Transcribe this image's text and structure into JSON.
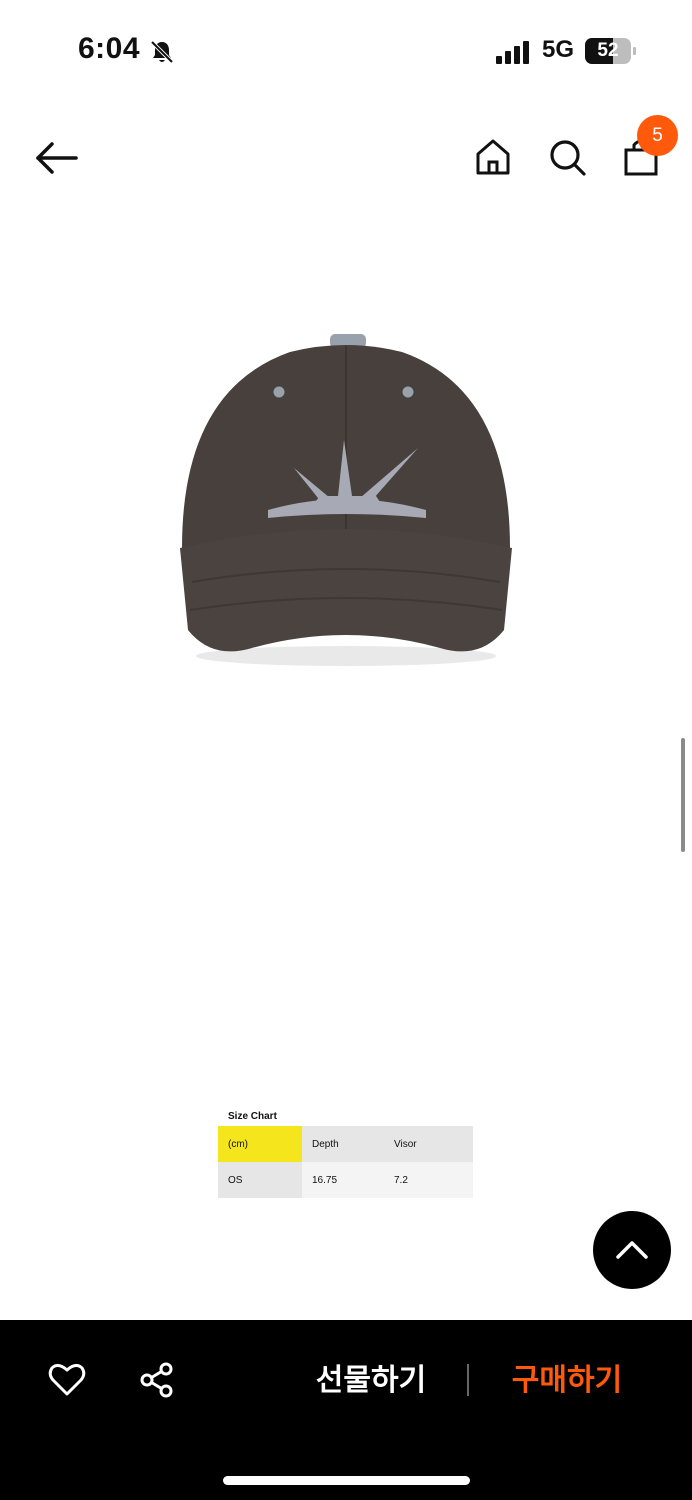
{
  "status": {
    "time": "6:04",
    "network": "5G",
    "battery": "52"
  },
  "nav": {
    "cart_count": "5"
  },
  "product": {
    "image_icon": "cap-product-image"
  },
  "size_chart": {
    "title": "Size Chart",
    "headers": [
      "(cm)",
      "Depth",
      "Visor"
    ],
    "rows": [
      [
        "OS",
        "16.75",
        "7.2"
      ]
    ],
    "highlight_color": "#f4e51c"
  },
  "actions": {
    "gift_label": "선물하기",
    "buy_label": "구매하기"
  },
  "colors": {
    "accent": "#ff5a0b",
    "bottom_bar": "#000000"
  }
}
